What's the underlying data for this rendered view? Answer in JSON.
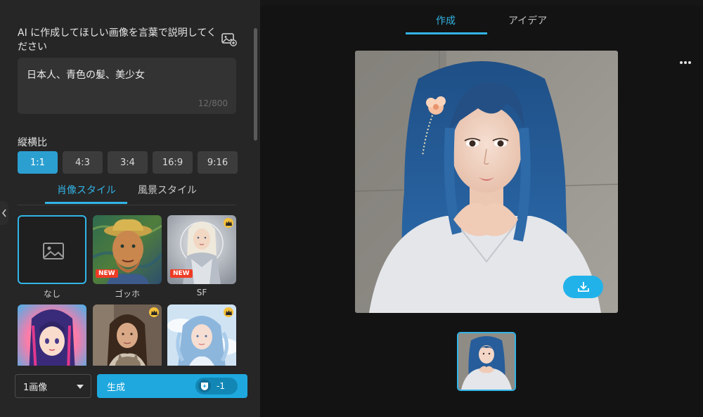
{
  "prompt": {
    "label": "AI に作成してほしい画像を言葉で説明してください",
    "value": "日本人、青色の髪、美少女",
    "char_count": "12/800"
  },
  "aspect": {
    "label": "縦横比",
    "options": [
      "1:1",
      "4:3",
      "3:4",
      "16:9",
      "9:16"
    ],
    "selected": "1:1"
  },
  "style_tabs": {
    "items": [
      "肖像スタイル",
      "風景スタイル"
    ],
    "active": "肖像スタイル"
  },
  "styles": [
    {
      "name": "なし",
      "badge": "",
      "premium": false,
      "selected": true
    },
    {
      "name": "ゴッホ",
      "badge": "NEW",
      "premium": false,
      "selected": false
    },
    {
      "name": "SF",
      "badge": "NEW",
      "premium": true,
      "selected": false
    },
    {
      "name": "",
      "badge": "",
      "premium": false,
      "selected": false
    },
    {
      "name": "",
      "badge": "",
      "premium": true,
      "selected": false
    },
    {
      "name": "",
      "badge": "",
      "premium": true,
      "selected": false
    }
  ],
  "bottom": {
    "count_select": "1画像",
    "generate_label": "生成",
    "credit_cost": "-1"
  },
  "top_tabs": {
    "items": [
      "作成",
      "アイデア"
    ],
    "active": "作成"
  },
  "colors": {
    "accent": "#32b4e6",
    "button": "#1ea8de",
    "new_badge": "#ee3b24",
    "premium": "#f5c03b"
  }
}
